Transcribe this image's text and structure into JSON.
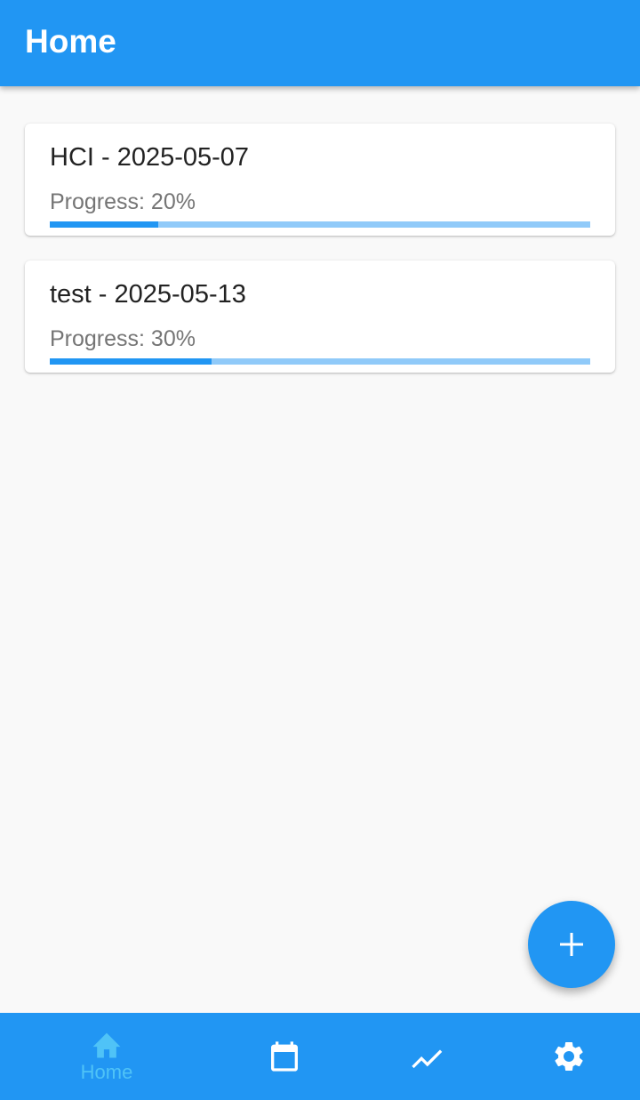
{
  "app_bar": {
    "title": "Home"
  },
  "tasks": [
    {
      "title": "HCI - 2025-05-07",
      "progress_text": "Progress: 20%",
      "progress": 0.2
    },
    {
      "title": "test - 2025-05-13",
      "progress_text": "Progress: 30%",
      "progress": 0.3
    }
  ],
  "fab": {
    "icon": "plus-icon"
  },
  "bottom_nav": {
    "items": [
      {
        "icon": "home-icon",
        "label": "Home",
        "active": true
      },
      {
        "icon": "calendar-icon",
        "label": "",
        "active": false
      },
      {
        "icon": "trending-up-icon",
        "label": "",
        "active": false
      },
      {
        "icon": "gear-icon",
        "label": "",
        "active": false
      }
    ]
  },
  "colors": {
    "primary": "#2196f3",
    "progress_track": "#90caf9",
    "nav_active": "#4fc3f7",
    "background": "#f9f9f9"
  }
}
